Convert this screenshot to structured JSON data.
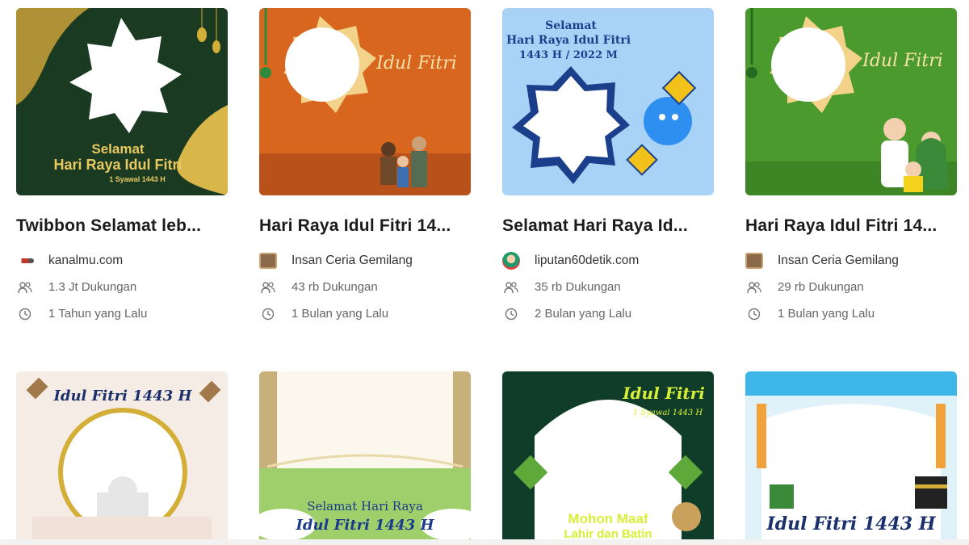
{
  "cards": [
    {
      "title": "Twibbon Selamat leb...",
      "author": "kanalmu.com",
      "supports": "1.3 Jt Dukungan",
      "age": "1 Tahun yang Lalu",
      "thumb_text": {
        "line1": "Selamat",
        "line2": "Hari Raya Idul Fitri",
        "line3": "1 Syawal 1443 H"
      },
      "colors": {
        "bg": "#1b3a22",
        "accent": "#d4af37"
      }
    },
    {
      "title": "Hari Raya Idul Fitri 14...",
      "author": "Insan Ceria Gemilang",
      "supports": "43 rb Dukungan",
      "age": "1 Bulan yang Lalu",
      "thumb_text": {
        "line1": "Idul Fitri"
      },
      "colors": {
        "bg": "#d8661f",
        "accent": "#f3d28a"
      }
    },
    {
      "title": "Selamat Hari Raya Id...",
      "author": "liputan60detik.com",
      "supports": "35 rb Dukungan",
      "age": "2 Bulan yang Lalu",
      "thumb_text": {
        "line1": "Selamat",
        "line2": "Hari Raya Idul Fitri",
        "line3": "1443 H / 2022 M"
      },
      "colors": {
        "bg": "#a9d3f6",
        "accent": "#1b3f8a"
      }
    },
    {
      "title": "Hari Raya Idul Fitri 14...",
      "author": "Insan Ceria Gemilang",
      "supports": "29 rb Dukungan",
      "age": "1 Bulan yang Lalu",
      "thumb_text": {
        "line1": "Idul Fitri"
      },
      "colors": {
        "bg": "#4a9a2e",
        "accent": "#f3d28a"
      }
    }
  ],
  "cards_row2": [
    {
      "thumb_text": {
        "line1": "Idul Fitri 1443 H"
      },
      "colors": {
        "bg": "#f6ece6",
        "accent": "#1b2f6a"
      }
    },
    {
      "thumb_text": {
        "line1": "Selamat Hari Raya",
        "line2": "Idul Fitri 1443 H"
      },
      "colors": {
        "bg": "#9fcf6b",
        "accent": "#1a3b8c"
      }
    },
    {
      "thumb_text": {
        "line1": "Idul Fitri",
        "line2": "1 Syawal 1443 H",
        "line3": "Mohon Maaf",
        "line4": "Lahir dan Batin"
      },
      "colors": {
        "bg": "#0f3d2a",
        "accent": "#d7ef37"
      }
    },
    {
      "thumb_text": {
        "line1": "Idul Fitri 1443 H"
      },
      "colors": {
        "bg": "#dff1f9",
        "accent": "#1b2f6a"
      }
    }
  ],
  "icons": {
    "supporters": "users-icon",
    "time": "clock-icon"
  }
}
